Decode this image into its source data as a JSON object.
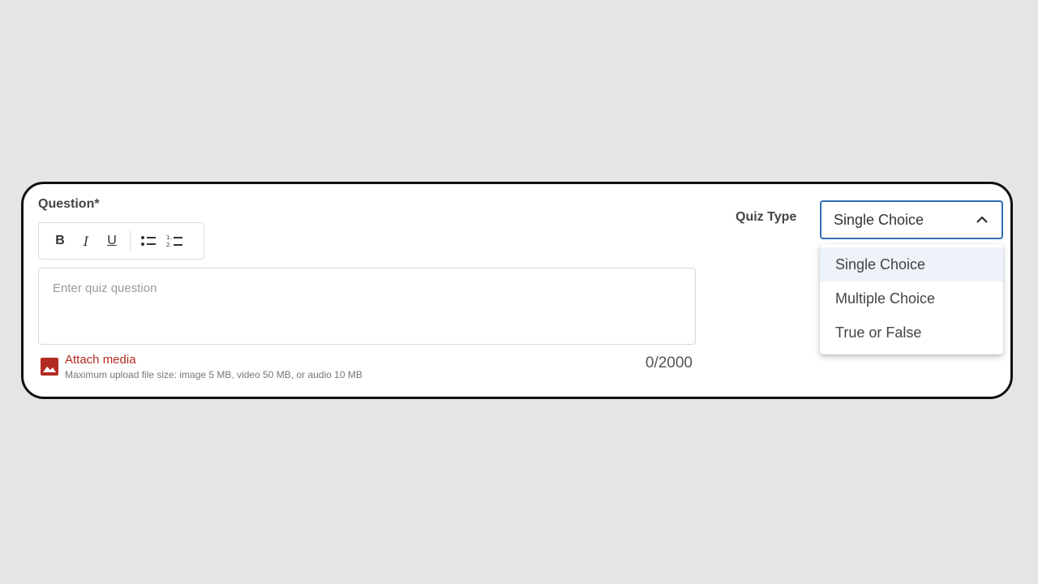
{
  "question": {
    "label": "Question*",
    "placeholder": "Enter quiz question",
    "value": "",
    "char_count": "0/2000"
  },
  "toolbar": {
    "bold": "B",
    "italic": "I",
    "underline": "U",
    "bullet_icon": "bulleted-list-icon",
    "numbered_icon": "numbered-list-icon"
  },
  "media": {
    "icon": "image-icon",
    "link": "Attach media",
    "hint": "Maximum upload file size: image 5 MB, video 50 MB, or audio 10 MB"
  },
  "quiz_type": {
    "label": "Quiz Type",
    "selected": "Single Choice",
    "chevron_icon": "chevron-up-icon",
    "options": [
      "Single Choice",
      "Multiple Choice",
      "True or False"
    ],
    "highlighted_index": 0
  },
  "colors": {
    "accent": "#2f6db5",
    "media_red": "#b22a20",
    "highlight": "#eef3f9"
  }
}
